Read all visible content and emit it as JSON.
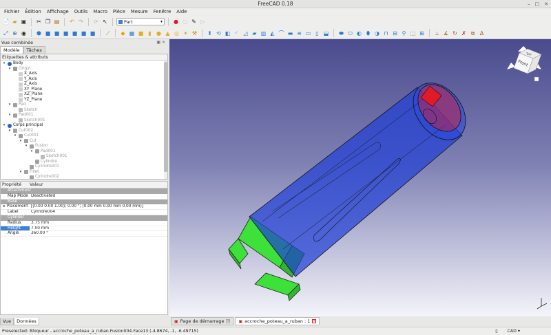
{
  "window": {
    "title": "FreeCAD 0.18"
  },
  "menu": [
    "Fichier",
    "Édition",
    "Affichage",
    "Outils",
    "Macro",
    "Pièce",
    "Mesure",
    "Fenêtre",
    "Aide"
  ],
  "toolbar": {
    "workbench": "Part"
  },
  "combo": {
    "title": "Vue combinée",
    "tabs": [
      "Modèle",
      "Tâches"
    ],
    "tree_header": "Etiquettes & attributs",
    "tree": [
      {
        "label": "Body",
        "depth": 1,
        "twisty": "▾",
        "grey": false,
        "icon": "body-icon"
      },
      {
        "label": "Origin",
        "depth": 2,
        "twisty": "▾",
        "grey": true,
        "icon": "origin-icon"
      },
      {
        "label": "X_Axis",
        "depth": 3,
        "twisty": "",
        "grey": false,
        "icon": "axis-icon"
      },
      {
        "label": "Y_Axis",
        "depth": 3,
        "twisty": "",
        "grey": false,
        "icon": "axis-icon"
      },
      {
        "label": "Z_Axis",
        "depth": 3,
        "twisty": "",
        "grey": false,
        "icon": "axis-icon"
      },
      {
        "label": "XY_Plane",
        "depth": 3,
        "twisty": "",
        "grey": false,
        "icon": "plane-icon"
      },
      {
        "label": "XZ_Plane",
        "depth": 3,
        "twisty": "",
        "grey": false,
        "icon": "plane-icon"
      },
      {
        "label": "YZ_Plane",
        "depth": 3,
        "twisty": "",
        "grey": false,
        "icon": "plane-icon"
      },
      {
        "label": "Pad",
        "depth": 2,
        "twisty": "▾",
        "grey": true,
        "icon": "pad-icon"
      },
      {
        "label": "Sketch",
        "depth": 3,
        "twisty": "",
        "grey": true,
        "icon": "sketch-icon"
      },
      {
        "label": "Pad001",
        "depth": 2,
        "twisty": "▾",
        "grey": true,
        "icon": "pad-icon"
      },
      {
        "label": "Sketch001",
        "depth": 3,
        "twisty": "",
        "grey": true,
        "icon": "sketch-icon"
      },
      {
        "label": "Corps principal",
        "depth": 1,
        "twisty": "▾",
        "grey": false,
        "icon": "body-icon"
      },
      {
        "label": "Cut002",
        "depth": 2,
        "twisty": "▾",
        "grey": true,
        "icon": "cut-icon"
      },
      {
        "label": "Cut001",
        "depth": 3,
        "twisty": "▾",
        "grey": true,
        "icon": "cut-icon"
      },
      {
        "label": "Cut",
        "depth": 4,
        "twisty": "▾",
        "grey": true,
        "icon": "cut-icon"
      },
      {
        "label": "Fusion",
        "depth": 5,
        "twisty": "▾",
        "grey": true,
        "icon": "fusion-icon"
      },
      {
        "label": "Pad001",
        "depth": 6,
        "twisty": "▾",
        "grey": true,
        "icon": "pad-icon"
      },
      {
        "label": "Sketch001",
        "depth": 7,
        "twisty": "",
        "grey": true,
        "icon": "sketch-icon"
      },
      {
        "label": "Cylindre",
        "depth": 6,
        "twisty": "",
        "grey": true,
        "icon": "cylinder-icon"
      },
      {
        "label": "Cylindre001",
        "depth": 5,
        "twisty": "",
        "grey": true,
        "icon": "cylinder-icon"
      },
      {
        "label": "Fillet",
        "depth": 4,
        "twisty": "▾",
        "grey": true,
        "icon": "fillet-icon"
      },
      {
        "label": "Cylindre002",
        "depth": 5,
        "twisty": "",
        "grey": true,
        "icon": "cylinder-icon"
      }
    ]
  },
  "properties": {
    "col_property": "Propriété",
    "col_value": "Valeur",
    "rows": [
      {
        "type": "group",
        "label": "Attachment"
      },
      {
        "type": "prop",
        "key": "Map Mode",
        "value": "Deactivated"
      },
      {
        "type": "group",
        "label": "Base"
      },
      {
        "type": "prop",
        "key": "Placement",
        "value": "[(0.00 0.00 1.00); 0.00 °; (0.00 mm  0.00 mm  0.00 mm)]",
        "expander": "▸"
      },
      {
        "type": "prop",
        "key": "Label",
        "value": "Cylindre004"
      },
      {
        "type": "group",
        "label": "Cylinder"
      },
      {
        "type": "prop",
        "key": "Radius",
        "value": "3.75 mm"
      },
      {
        "type": "prop",
        "key": "Height",
        "value": "7.00 mm",
        "selected": true
      },
      {
        "type": "prop",
        "key": "Angle",
        "value": "360.00 °"
      }
    ],
    "tabs": [
      "Vue",
      "Données"
    ]
  },
  "navcube": {
    "face": "Front",
    "top": "Top"
  },
  "doc_tabs": [
    {
      "label": "Page de démarrage",
      "active": false
    },
    {
      "label": "accroche_poteau_a_ruban : 1",
      "active": true
    }
  ],
  "status": {
    "message": "Preselected: Bloqueur - accroche_poteau_a_ruban.Fusion004.Face13 (-4.8674, -1, -6.49715)",
    "nav_style": "CAD"
  },
  "colors": {
    "blue_body": "#1f3fd6",
    "green": "#3ee03a",
    "red": "#e11a2a",
    "accent": "#3d80d8"
  }
}
